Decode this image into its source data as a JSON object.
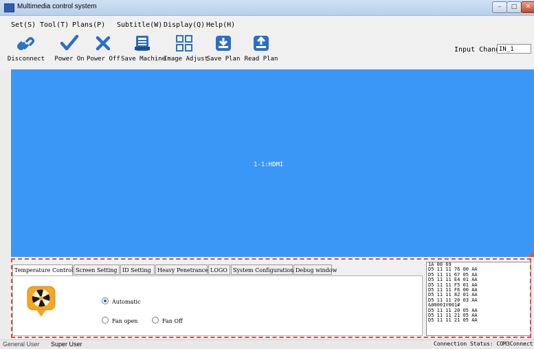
{
  "window": {
    "title": "Multimedia control system",
    "buttons": {
      "min": "–",
      "max": "□",
      "close": "✕"
    }
  },
  "menu": [
    "Set(S)",
    "Tool(T)",
    "Plans(P)",
    "Subtitle(W)",
    "Display(Q)",
    "Help(H)"
  ],
  "toolbar": {
    "items": [
      {
        "label": "Disconnect",
        "icon": "link-icon"
      },
      {
        "label": "Power On",
        "icon": "checkmark-icon"
      },
      {
        "label": "Power Off",
        "icon": "x-icon"
      },
      {
        "label": "Save Machine",
        "icon": "machine-save-icon"
      },
      {
        "label": "Image Adjust",
        "icon": "grid-icon"
      },
      {
        "label": "Save Plan",
        "icon": "download-tray-icon"
      },
      {
        "label": "Read Plan",
        "icon": "upload-tray-icon"
      }
    ],
    "input_channel_label": "Input Channel:",
    "input_channel_value": "IN_1"
  },
  "screen": {
    "label": "1-1:HDMI",
    "background": "#3b97f5"
  },
  "tabs": [
    "Temperature Control",
    "Screen Setting",
    "ID Setting",
    "Heavy Penetrance",
    "LOGO",
    "System Configuration",
    "Debug window"
  ],
  "active_tab": "Temperature Control",
  "temperature": {
    "options": [
      {
        "label": "Automatic",
        "selected": true
      },
      {
        "label": "Fan open",
        "selected": false
      },
      {
        "label": "Fan Off",
        "selected": false
      }
    ]
  },
  "debug_log": [
    "1A 00 69",
    "D5 11 11 76 00 AA",
    "D5 11 11 67 05 AA",
    "D5 11 11 E4 01 AA",
    "D5 11 11 F5 01 AA",
    "D5 11 11 F6 00 AA",
    "D5 11 11 82 01 AA",
    "D5 11 11 20 03 AA",
    "&00001V001#",
    "D5 11 11 20 05 AA",
    "D5 11 11 21 05 AA",
    "D5 11 11 21 05 AA"
  ],
  "status": {
    "user_role": "General User",
    "user_name": "Super User",
    "connection": "Connection Status: COM3Connect"
  }
}
